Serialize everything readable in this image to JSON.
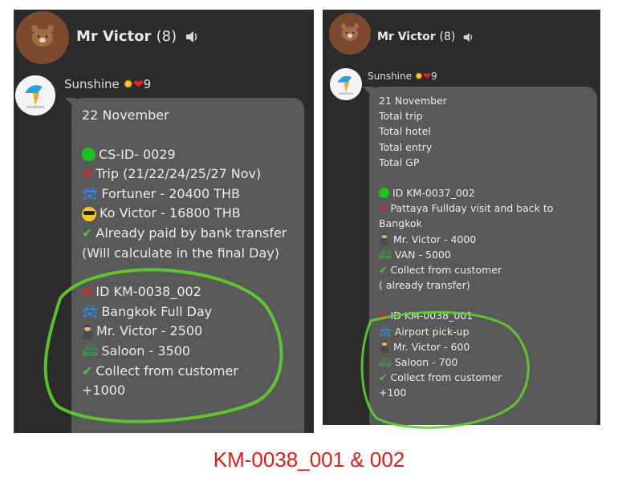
{
  "left": {
    "header": {
      "name": "Mr Victor",
      "count": "(8)"
    },
    "sender": {
      "name": "Sunshine",
      "suffix": "9"
    },
    "message": {
      "date": "22 November",
      "lines": [
        {
          "icon": "green-circle-icon",
          "text": "CS-ID- 0029"
        },
        {
          "icon": "red-burst-icon",
          "text": "Trip (21/22/24/25/27 Nov)"
        },
        {
          "icon": "car-icon",
          "text": "Fortuner - 20400 THB"
        },
        {
          "icon": "sunglasses-face-icon",
          "text": "Ko Victor - 16800 THB"
        },
        {
          "icon": "check-icon",
          "text": "Already paid by bank transfer"
        },
        {
          "icon": "",
          "text": "(Will calculate in the final Day)"
        }
      ],
      "lines2": [
        {
          "icon": "red-burst-icon",
          "text": "ID KM-0038_002"
        },
        {
          "icon": "car-icon",
          "text": "Bangkok Full Day"
        },
        {
          "icon": "person-icon",
          "text": " Mr. Victor - 2500"
        },
        {
          "icon": "van-icon",
          "text": " Saloon - 3500"
        },
        {
          "icon": "check-icon",
          "text": " Collect from customer"
        },
        {
          "icon": "",
          "text": "+1000"
        }
      ]
    }
  },
  "right": {
    "header": {
      "name": "Mr Victor",
      "count": "(8)"
    },
    "sender": {
      "name": "Sunshine",
      "suffix": "9"
    },
    "message": {
      "lines1": [
        "21 November",
        "Total trip",
        "Total hotel",
        "Total entry",
        "Total GP"
      ],
      "lines2": [
        {
          "icon": "green-circle-icon",
          "text": "ID KM-0037_002"
        },
        {
          "icon": "red-burst-icon",
          "text": "Pattaya Fullday visit and back to"
        },
        {
          "icon": "",
          "text": "Bangkok"
        },
        {
          "icon": "person-icon",
          "text": " Mr. Victor - 4000"
        },
        {
          "icon": "van-icon",
          "text": " VAN - 5000"
        },
        {
          "icon": "check-icon",
          "text": " Collect from customer"
        },
        {
          "icon": "",
          "text": "( already transfer)"
        }
      ],
      "lines3": [
        {
          "icon": "red-burst-icon",
          "text": "ID KM-0038_001"
        },
        {
          "icon": "car-icon",
          "text": "Airport pick-up"
        },
        {
          "icon": "person-icon",
          "text": " Mr. Victor - 600"
        },
        {
          "icon": "van-icon",
          "text": " Saloon - 700"
        },
        {
          "icon": "check-icon",
          "text": " Collect from customer"
        },
        {
          "icon": "",
          "text": "+100"
        }
      ]
    }
  },
  "caption": "KM-0038_001 & 002",
  "colors": {
    "panel": "#2b2b2b",
    "bubble": "#595959",
    "highlight": "#5fcf2f",
    "caption": "#e31b1b"
  }
}
